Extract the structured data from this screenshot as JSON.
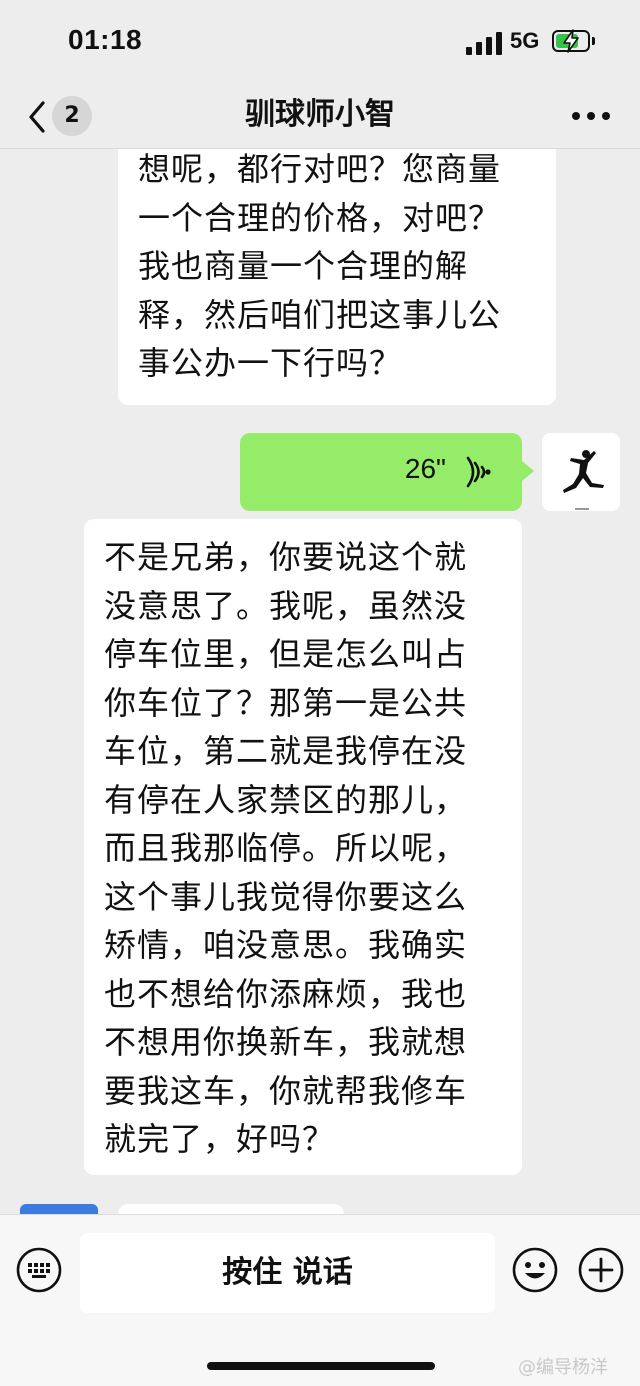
{
  "status_bar": {
    "time": "01:18",
    "network": "5G"
  },
  "header": {
    "unread_count": "2",
    "title": "驯球师小智"
  },
  "messages": [
    {
      "side": "left",
      "type": "text",
      "text": "想呢，都行对吧？您商量\n一个合理的价格，对吧？\n我也商量一个合理的解\n释，然后咱们把这事儿公\n事公办一下行吗？"
    },
    {
      "side": "right",
      "type": "voice",
      "duration": "26\""
    },
    {
      "side": "left",
      "type": "text",
      "text": "不是兄弟，你要说这个就\n没意思了。我呢，虽然没\n停车位里，但是怎么叫占\n你车位了？那第一是公共\n车位，第二就是我停在没\n有停在人家禁区的那儿，\n而且我那临停。所以呢，\n这个事儿我觉得你要这么\n矫情，咱没意思。我确实\n也不想给你添麻烦，我也\n不想用你换新车，我就想\n要我这车，你就帮我修车\n就完了，好吗？"
    }
  ],
  "input_bar": {
    "talk_label": "按住 说话"
  },
  "watermark": "@编导杨洋",
  "colors": {
    "self_bubble": "#95ec69",
    "other_bubble": "#ffffff",
    "background": "#ededed"
  },
  "icons": [
    "back-icon",
    "more-icon",
    "voice-wave-icon",
    "jordan-logo-avatar",
    "keyboard-icon",
    "emoji-icon",
    "plus-icon"
  ]
}
